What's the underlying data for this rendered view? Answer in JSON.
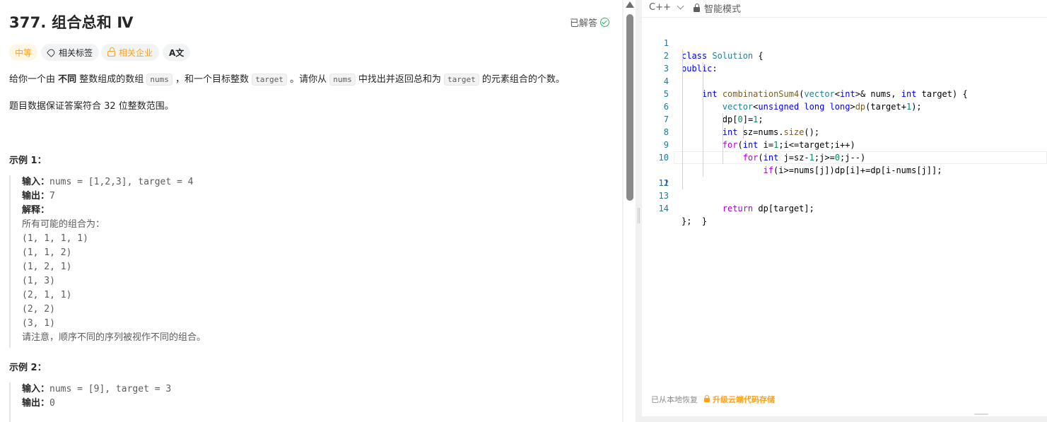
{
  "problem": {
    "title": "377. 组合总和 Ⅳ",
    "solved_label": "已解答",
    "tags": {
      "difficulty": "中等",
      "topics": "相关标签",
      "companies": "相关企业",
      "translate": "A文"
    },
    "description": {
      "p1_a": "给你一个由 ",
      "p1_bold": "不同",
      "p1_b": " 整数组成的数组 ",
      "p1_code1": "nums",
      "p1_c": " ，和一个目标整数 ",
      "p1_code2": "target",
      "p1_d": " 。请你从 ",
      "p1_code3": "nums",
      "p1_e": " 中找出并返回总和为 ",
      "p1_code4": "target",
      "p1_f": " 的元素组合的个数。",
      "p2": "题目数据保证答案符合 32 位整数范围。"
    },
    "examples": [
      {
        "title": "示例 1：",
        "input_key": "输入：",
        "input_val": "nums = [1,2,3], target = 4",
        "output_key": "输出：",
        "output_val": "7",
        "explain_key": "解释：",
        "explain_lines": [
          "所有可能的组合为：",
          "(1, 1, 1, 1)",
          "(1, 1, 2)",
          "(1, 2, 1)",
          "(1, 3)",
          "(2, 1, 1)",
          "(2, 2)",
          "(3, 1)",
          "请注意，顺序不同的序列被视作不同的组合。"
        ]
      },
      {
        "title": "示例 2：",
        "input_key": "输入：",
        "input_val": "nums = [9], target = 3",
        "output_key": "输出：",
        "output_val": "0"
      }
    ]
  },
  "editor": {
    "language": "C++",
    "mode": "智能模式",
    "line_numbers": [
      "1",
      "2",
      "3",
      "4",
      "5",
      "6",
      "7",
      "8",
      "9",
      "10",
      "11",
      "12",
      "13",
      "14"
    ],
    "active_line": "11",
    "footer_restore": "已从本地恢复",
    "footer_upgrade": "升级云端代码存储"
  },
  "colors": {
    "accent_orange": "#ffa116",
    "solved_green": "#2db55d",
    "keyword_blue": "#0000ff",
    "type_teal": "#267f99",
    "control_purple": "#af00db",
    "number_green": "#098658"
  }
}
